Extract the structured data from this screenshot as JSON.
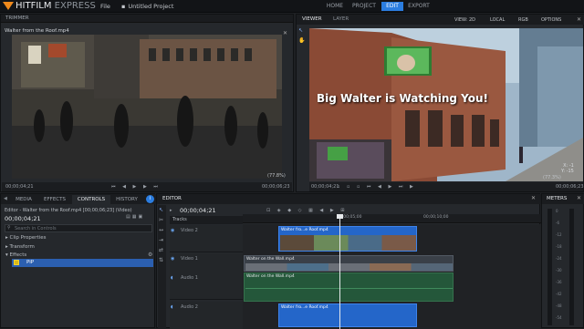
{
  "app": {
    "logo_bold": "HITFILM",
    "logo_light": " EXPRESS",
    "menu": [
      "File",
      "Untitled Project"
    ],
    "nav": [
      "HOME",
      "PROJECT",
      "EDIT",
      "EXPORT"
    ]
  },
  "trimmer": {
    "title": "TRIMMER",
    "clip_name": "Walter from the Roof.mp4",
    "zoom": "(77.8%)",
    "time_left": "00;00;04;21",
    "time_right": "00;00;06;23"
  },
  "viewer": {
    "tabs": [
      "VIEWER",
      "LAYER"
    ],
    "view_label": "VIEW: 2D",
    "local_label": "LOCAL",
    "rgb_label": "RGB",
    "options_label": "OPTIONS",
    "overlay_text": "Big Walter is Watching You!",
    "zoom": "(77.3%)",
    "time_left": "00;00;04;21",
    "time_right": "00;00;06;23",
    "coords": [
      "X:",
      "Y:"
    ],
    "coord_vals": [
      "-1",
      "-15"
    ]
  },
  "left": {
    "tabs": [
      "MEDIA",
      "EFFECTS",
      "CONTROLS",
      "HISTORY"
    ],
    "editor_title": "Editor - Walter from the Roof.mp4 [00;00;06;23] (Video)",
    "timecode": "00;00;04;21",
    "search_placeholder": "Search in Controls",
    "groups": [
      "Clip Properties",
      "Transform",
      "Effects"
    ],
    "effect": "PiP"
  },
  "editor": {
    "title": "EDITOR",
    "timecode": "00;00;04;21",
    "tracks_label": "Tracks",
    "ruler": [
      "00;00;05;00",
      "00;00;10;00"
    ],
    "tracks": [
      "Video 2",
      "Video 1",
      "Audio 1",
      "Audio 2"
    ],
    "clips": {
      "video2": "Walter fro...e Roof.mp4",
      "video1": "Walter on the Wall.mp4",
      "audio1": "Walter on the Wall.mp4",
      "audio2": "Walter fro...e Roof.mp4"
    }
  },
  "meters": {
    "title": "METERS",
    "ticks": [
      "0",
      "-6",
      "-12",
      "-18",
      "-24",
      "-30",
      "-36",
      "-42",
      "-48",
      "-54"
    ]
  }
}
